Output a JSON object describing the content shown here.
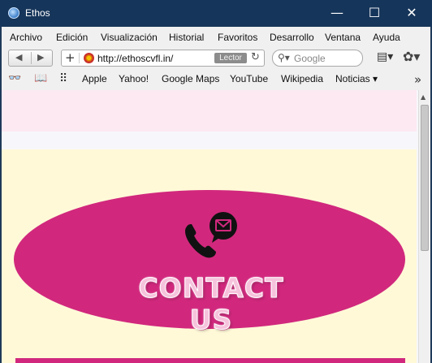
{
  "window": {
    "title": "Ethos",
    "minimize_glyph": "—",
    "maximize_glyph": "☐",
    "close_glyph": "✕"
  },
  "menu": [
    "Archivo",
    "Edición",
    "Visualización",
    "Historial",
    "Favoritos",
    "Desarrollo",
    "Ventana",
    "Ayuda"
  ],
  "toolbar": {
    "back_glyph": "◀",
    "forward_glyph": "▶",
    "plus_glyph": "+",
    "url": "http://ethoscvfl.in/",
    "reader_label": "Lector",
    "reload_glyph": "↻",
    "search_glyph": "⚲▾",
    "search_placeholder": "Google",
    "page_menu_glyph": "▤▾",
    "settings_glyph": "✿▾"
  },
  "bookmarks": {
    "reading_list_glyph": "👓",
    "book_glyph": "📖",
    "grid_glyph": "⠿",
    "items": [
      "Apple",
      "Yahoo!",
      "Google Maps",
      "YouTube",
      "Wikipedia",
      "Noticias ▾"
    ],
    "more_glyph": "»"
  },
  "page": {
    "contact_title": "CONTACT US"
  },
  "scrollbar": {
    "up_glyph": "▲"
  },
  "colors": {
    "titlebar": "#16355a",
    "accent_magenta": "#d1287d",
    "cream_band": "#fff9d8",
    "pink_band": "#fde9f2"
  }
}
